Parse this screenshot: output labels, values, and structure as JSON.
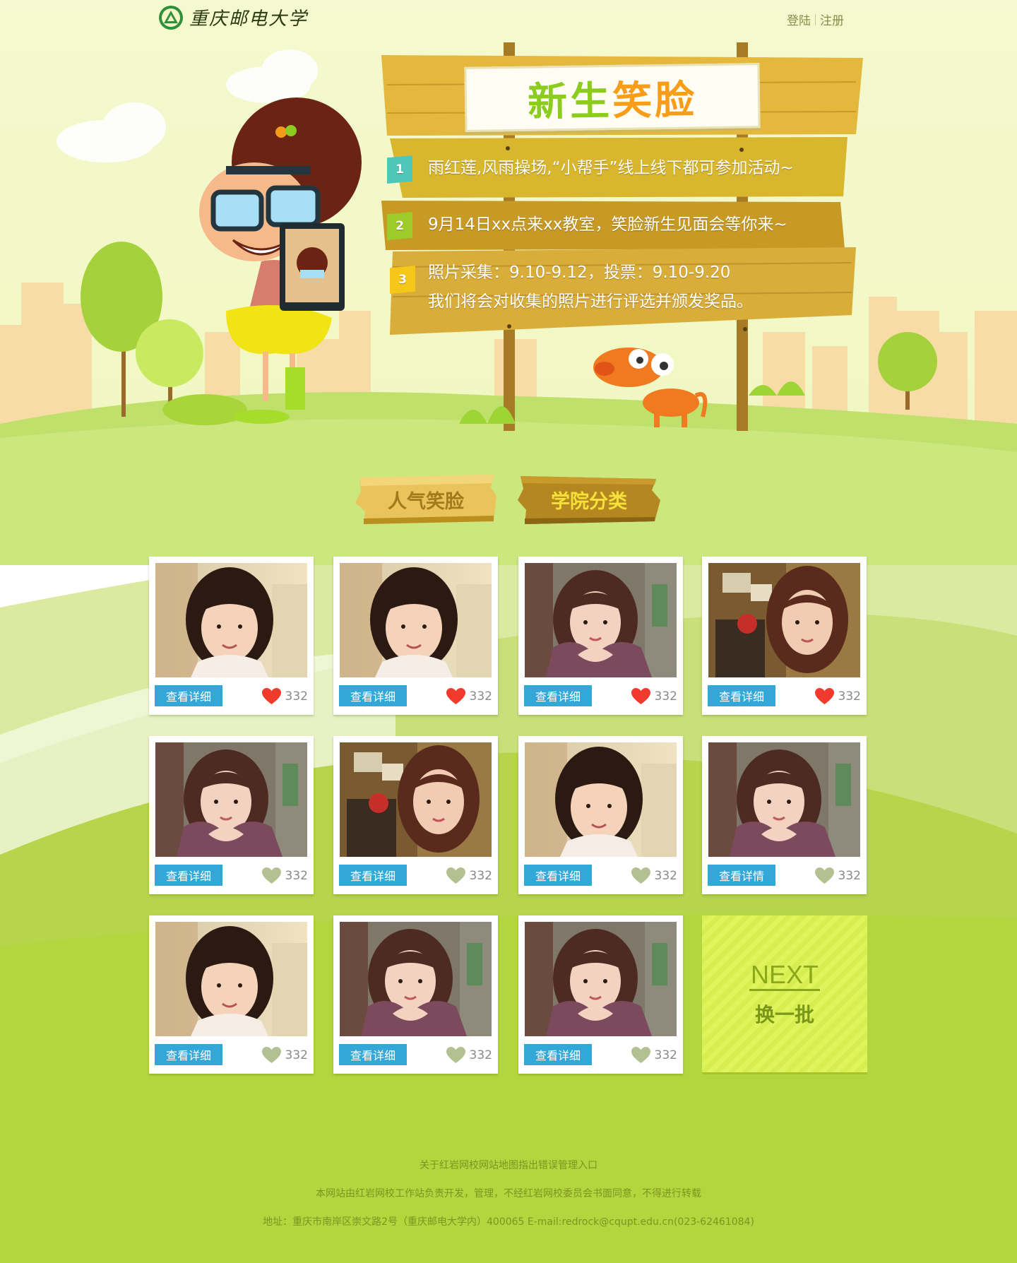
{
  "header": {
    "logo_text": "重庆邮电大学",
    "login": "登陆",
    "register": "注册"
  },
  "sign": {
    "title": "新生笑脸",
    "notices": [
      {
        "num": "1",
        "color": "#4fc7b8",
        "lines": [
          "雨红莲,风雨操场,“小帮手”线上线下都可参加活动~"
        ]
      },
      {
        "num": "2",
        "color": "#9dcb2a",
        "lines": [
          "9月14日xx点来xx教室，笑脸新生见面会等你来~"
        ]
      },
      {
        "num": "3",
        "color": "#f4c718",
        "lines": [
          "照片采集：9.10-9.12，投票：9.10-9.20",
          "我们将会对收集的照片进行评选并颁发奖品。"
        ]
      }
    ]
  },
  "tabs": [
    {
      "label": "人气笑脸"
    },
    {
      "label": "学院分类"
    }
  ],
  "cards": [
    {
      "photo": "A",
      "detail": "查看详细",
      "likes": "332",
      "liked": true
    },
    {
      "photo": "A",
      "detail": "查看详细",
      "likes": "332",
      "liked": true
    },
    {
      "photo": "B",
      "detail": "查看详细",
      "likes": "332",
      "liked": true
    },
    {
      "photo": "C",
      "detail": "查看详细",
      "likes": "332",
      "liked": true
    },
    {
      "photo": "B",
      "detail": "查看详细",
      "likes": "332",
      "liked": false
    },
    {
      "photo": "C",
      "detail": "查看详细",
      "likes": "332",
      "liked": false
    },
    {
      "photo": "A",
      "detail": "查看详细",
      "likes": "332",
      "liked": false
    },
    {
      "photo": "B",
      "detail": "查看详情",
      "likes": "332",
      "liked": false
    },
    {
      "photo": "A",
      "detail": "查看详细",
      "likes": "332",
      "liked": false
    },
    {
      "photo": "B",
      "detail": "查看详细",
      "likes": "332",
      "liked": false
    },
    {
      "photo": "B",
      "detail": "查看详细",
      "likes": "332",
      "liked": false
    }
  ],
  "next": {
    "word": "NEXT",
    "label": "换一批"
  },
  "footer": {
    "links": [
      "关于红岩网校",
      "网站地图",
      "指出错误",
      "管理入口"
    ],
    "disclaimer": "本网站由红岩网校工作站负责开发，管理，不经红岩网校委员会书面同意，不得进行转载",
    "address": "地址：重庆市南岸区崇文路2号（重庆邮电大学内）400065 E-mail:redrock@cqupt.edu.cn(023-62461084)"
  },
  "colors": {
    "accent_blue": "#33a8d8",
    "heart_liked": "#f03a2c",
    "heart_unliked": "#b3c091",
    "grass": "#a9d53a"
  }
}
